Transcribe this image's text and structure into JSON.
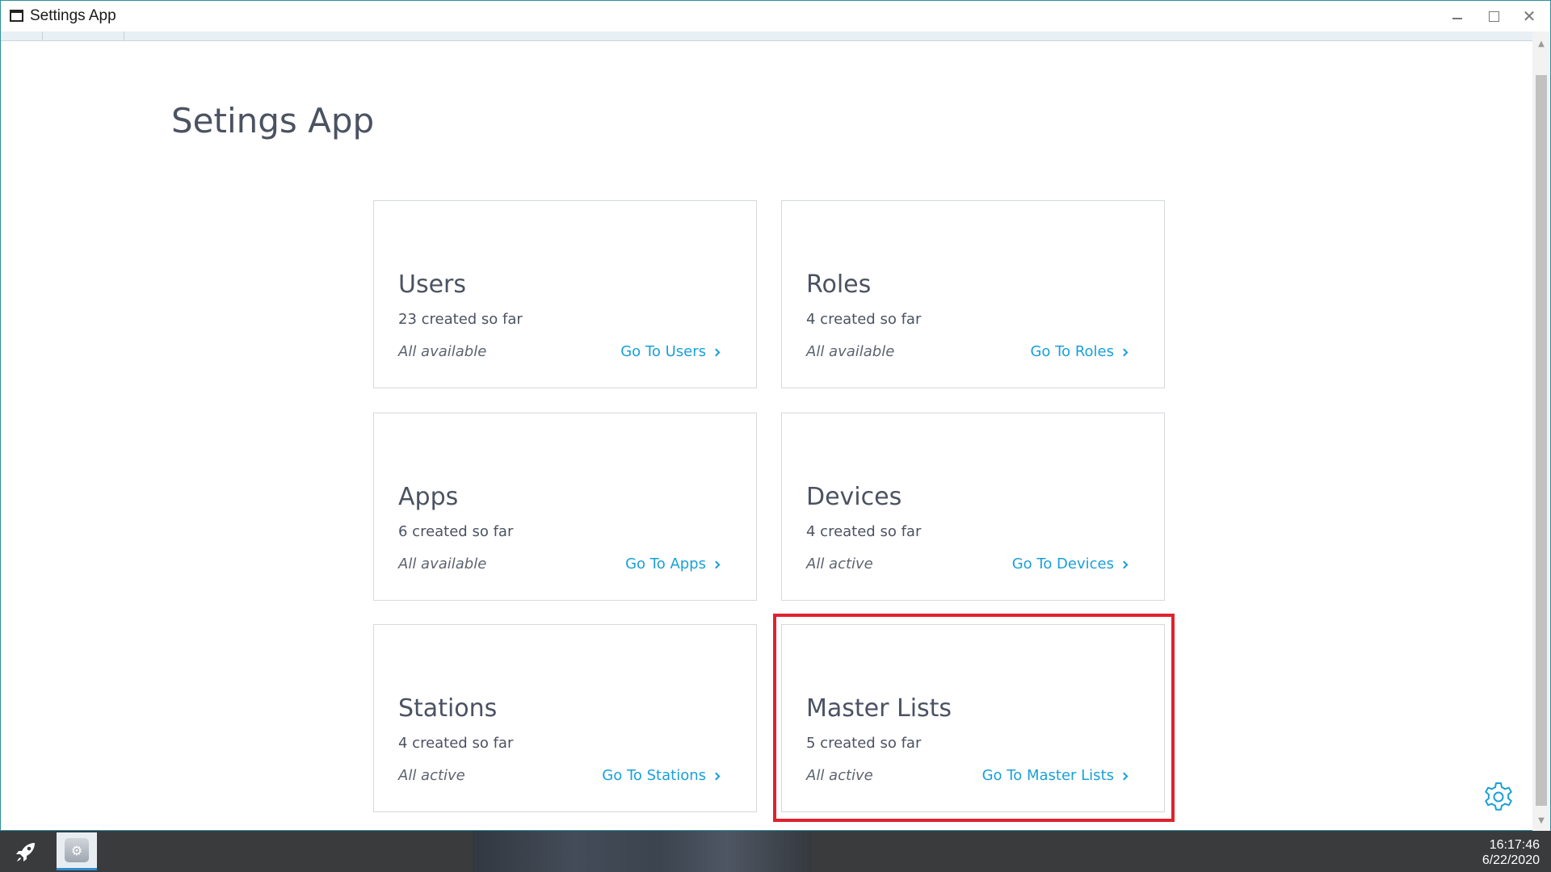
{
  "window": {
    "title": "Settings App",
    "close_glyph": "✕"
  },
  "page": {
    "title": "Setings App"
  },
  "cards": [
    {
      "title": "Users",
      "count": "23 created so far",
      "status": "All available",
      "link": "Go To Users"
    },
    {
      "title": "Roles",
      "count": "4 created so far",
      "status": "All available",
      "link": "Go To Roles"
    },
    {
      "title": "Apps",
      "count": "6 created so far",
      "status": "All available",
      "link": "Go To Apps"
    },
    {
      "title": "Devices",
      "count": "4 created so far",
      "status": "All active",
      "link": "Go To Devices"
    },
    {
      "title": "Stations",
      "count": "4 created so far",
      "status": "All active",
      "link": "Go To Stations"
    },
    {
      "title": "Master Lists",
      "count": "5 created so far",
      "status": "All active",
      "link": "Go To Master Lists"
    }
  ],
  "icons": {
    "settings_fab": "gear-icon",
    "start": "rocket-icon",
    "taskbar_app": "settings-app-icon"
  },
  "colors": {
    "accent": "#1aa0d8",
    "text": "#4b5262",
    "highlight": "#e0222f",
    "taskbar": "#3a3b3d"
  },
  "taskbar": {
    "time": "16:17:46",
    "date": "6/22/2020"
  }
}
